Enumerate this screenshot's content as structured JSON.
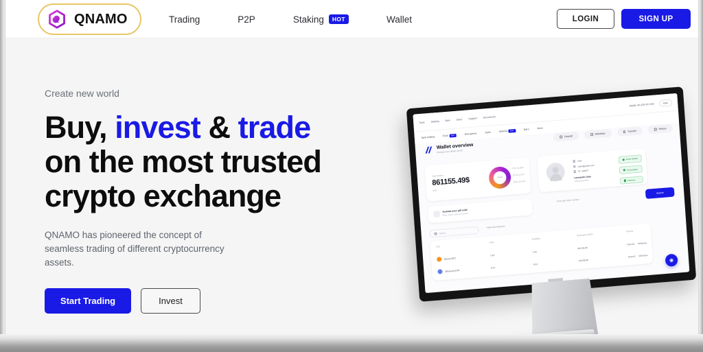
{
  "header": {
    "brand": {
      "name": "QNAMO",
      "logo_icon": "hexagon-logo-icon",
      "accent": "#b01ed0",
      "ring_color": "#e8c766"
    },
    "nav": [
      {
        "label": "Trading",
        "badge": null
      },
      {
        "label": "P2P",
        "badge": null
      },
      {
        "label": "Staking",
        "badge": "HOT"
      },
      {
        "label": "Wallet",
        "badge": null
      }
    ],
    "login_label": "LOGIN",
    "signup_label": "SIGN UP",
    "accent_blue": "#1a1ae6"
  },
  "hero": {
    "eyebrow": "Create new world",
    "headline": {
      "line1_a": "Buy,",
      "line1_b": "invest",
      "line1_c": "&",
      "line1_d": "trade",
      "line2": "on the most trusted",
      "line3": "crypto exchange"
    },
    "subtitle": "QNAMO has pioneered the concept of seamless trading of different cryptocurrency assets.",
    "primary_cta": "Start Trading",
    "secondary_cta": "Invest"
  },
  "mockup": {
    "device": "desktop-monitor",
    "topbar": {
      "items": [
        "Exchange",
        "Earn",
        "Derivatives",
        "Tools",
        "Staking",
        "Earn",
        "More",
        "Support",
        "Documents"
      ],
      "wallet_chip": "Wallet: 80,130.40 USD",
      "user_chip": "User"
    },
    "nav2": [
      "Spot trading",
      "Pool",
      "Derivatives",
      "Tools",
      "Staking",
      "Earn",
      "More"
    ],
    "wallet": {
      "title": "Wallet overview",
      "subtitle": "Manage your digital assets",
      "chips": [
        "Deposit",
        "Withdraw",
        "Transfer",
        "History"
      ]
    },
    "balance": {
      "label": "Total balance",
      "value": "861155.49$",
      "currency": "USD",
      "donut_label": "Assets",
      "legend": [
        "BTC 43.29%",
        "ETH 31.14%",
        "Other 25.57%"
      ],
      "donut_colors": [
        "#f09819",
        "#ef5f9a",
        "#a020d8"
      ]
    },
    "profile": {
      "rows": [
        "User",
        "User@gmail.com",
        "ID: 230837"
      ],
      "name": "Leonardo Lima",
      "address": "0x8A2c4b1d7E41",
      "verifications": [
        "Email verified",
        "2FA enabled",
        "Premium"
      ]
    },
    "gift": {
      "title": "Activate your gift code",
      "subtitle": "Enter code to claim your bonus",
      "input_placeholder": "Enter gift code number",
      "button": "Submit"
    },
    "table": {
      "search_placeholder": "Search",
      "hide_label": "Hide zero balances",
      "headers": [
        "Coin",
        "Total",
        "Available",
        "Estimated (USD)",
        "Actions"
      ],
      "rows": [
        {
          "coin": "Bitcoin BTC",
          "total": "1.42",
          "available": "1.42",
          "usd": "48,120.00",
          "actions": [
            "Deposit",
            "Withdraw"
          ]
        },
        {
          "coin": "Ethereum ETH",
          "total": "8.11",
          "available": "8.11",
          "usd": "26,440.00",
          "actions": [
            "Deposit",
            "Withdraw"
          ]
        }
      ]
    },
    "fab_icon": "chat-support-icon"
  }
}
